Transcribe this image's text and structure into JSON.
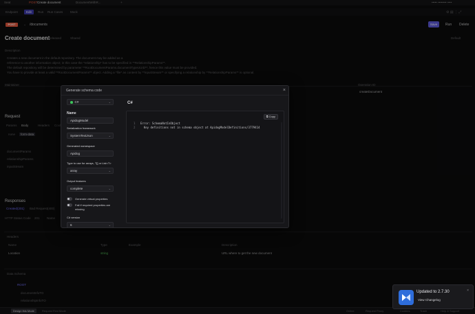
{
  "titlebar": {
    "left_tab": "Seat",
    "active_tab_method": "POST",
    "active_tab": "Create document",
    "second_tab": "DocumentWithR...",
    "right_text": "••••• •••••••• ••••"
  },
  "menubar": {
    "items": [
      "Endpoint",
      "Edit",
      "Run",
      "Run Cases",
      "Mock"
    ],
    "active_index": 1
  },
  "request": {
    "method": "POST",
    "path": "/documents",
    "save_label": "Save",
    "run_label": "Run",
    "delete_label": "Delete"
  },
  "page": {
    "title": "Create document",
    "released": "Released",
    "shared": "Shared",
    "status": "Default",
    "description_label": "Description",
    "description_lines": [
      "Creates a new document in the default repository. The document may be added as a",
      "reference to another information object; in this case the *relationship* has to be specified in **RelationshipParams**.",
      "The default repository will be determined by parameter **RootDocumentParams.documentTypeUUID**, hence this value must be provided.",
      "You have to provide at least a valid **RootDocumentParams** object. Adding a *file* as content by **inputStream** or specifying a relationship by **RelationshipParams** is optional."
    ],
    "maintainer_label": "Maintainer",
    "operation_label": "Operation ID",
    "operation_id": "createDocument",
    "request_label": "Request",
    "params_tabs": [
      "Params",
      "Body",
      "Headers",
      "Cookies"
    ],
    "body_types": [
      "none",
      "form-data"
    ],
    "body_rows": [
      "documentParams",
      "relationshipParams",
      "inputStream"
    ],
    "responses_label": "Responses",
    "response_tabs": [
      "Created(201)",
      "Bad Request(400)"
    ],
    "http_status_label": "HTTP Status Code",
    "http_status_code": "201",
    "name_label": "Name",
    "headers_label": "Headers",
    "header_cols": [
      "Name",
      "Type",
      "Example",
      "Description"
    ],
    "header_row": {
      "name": "Location",
      "type": "string",
      "description": "URL where to get the new document"
    },
    "data_schema_label": "Data Schema",
    "schema_rows": [
      "ROOT",
      "documentInfoTO",
      "relationshipInfoTO"
    ]
  },
  "modal": {
    "title": "Generate schema code",
    "language": "C#",
    "name_label": "Name",
    "name_value": "ApidogModel",
    "serialization_label": "Serialization framework",
    "serialization_value": "SystemTextJson",
    "namespace_label": "Generated namespace",
    "namespace_value": "Apidog",
    "array_type_label": "Type to use for arrays, T[] or List<T>",
    "array_type_value": "array",
    "output_label": "Output features",
    "output_value": "complete",
    "toggle_virtual": "Generate virtual properties",
    "toggle_fail_line1": "Fail if required properties are",
    "toggle_fail_line2": "missing",
    "csharp_version_label": "C# version",
    "csharp_version_value": "6",
    "code_title": "C#",
    "copy_label": "Copy",
    "code_lines": [
      {
        "no": "1",
        "text": "Error: SchemaNotInObject"
      },
      {
        "no": "2",
        "text": "  Key definitions not in schema object at ApidogModelDefinitions/3779414"
      }
    ]
  },
  "toast": {
    "title": "Updated to 2.7.30",
    "link": "View Changelog"
  },
  "statusbar": {
    "left_items": [
      "Design this Mode",
      "Request First Mode"
    ],
    "right_items": [
      "Online",
      "Request Proxy",
      "Cookies",
      "Trash",
      "Help & Support"
    ]
  }
}
